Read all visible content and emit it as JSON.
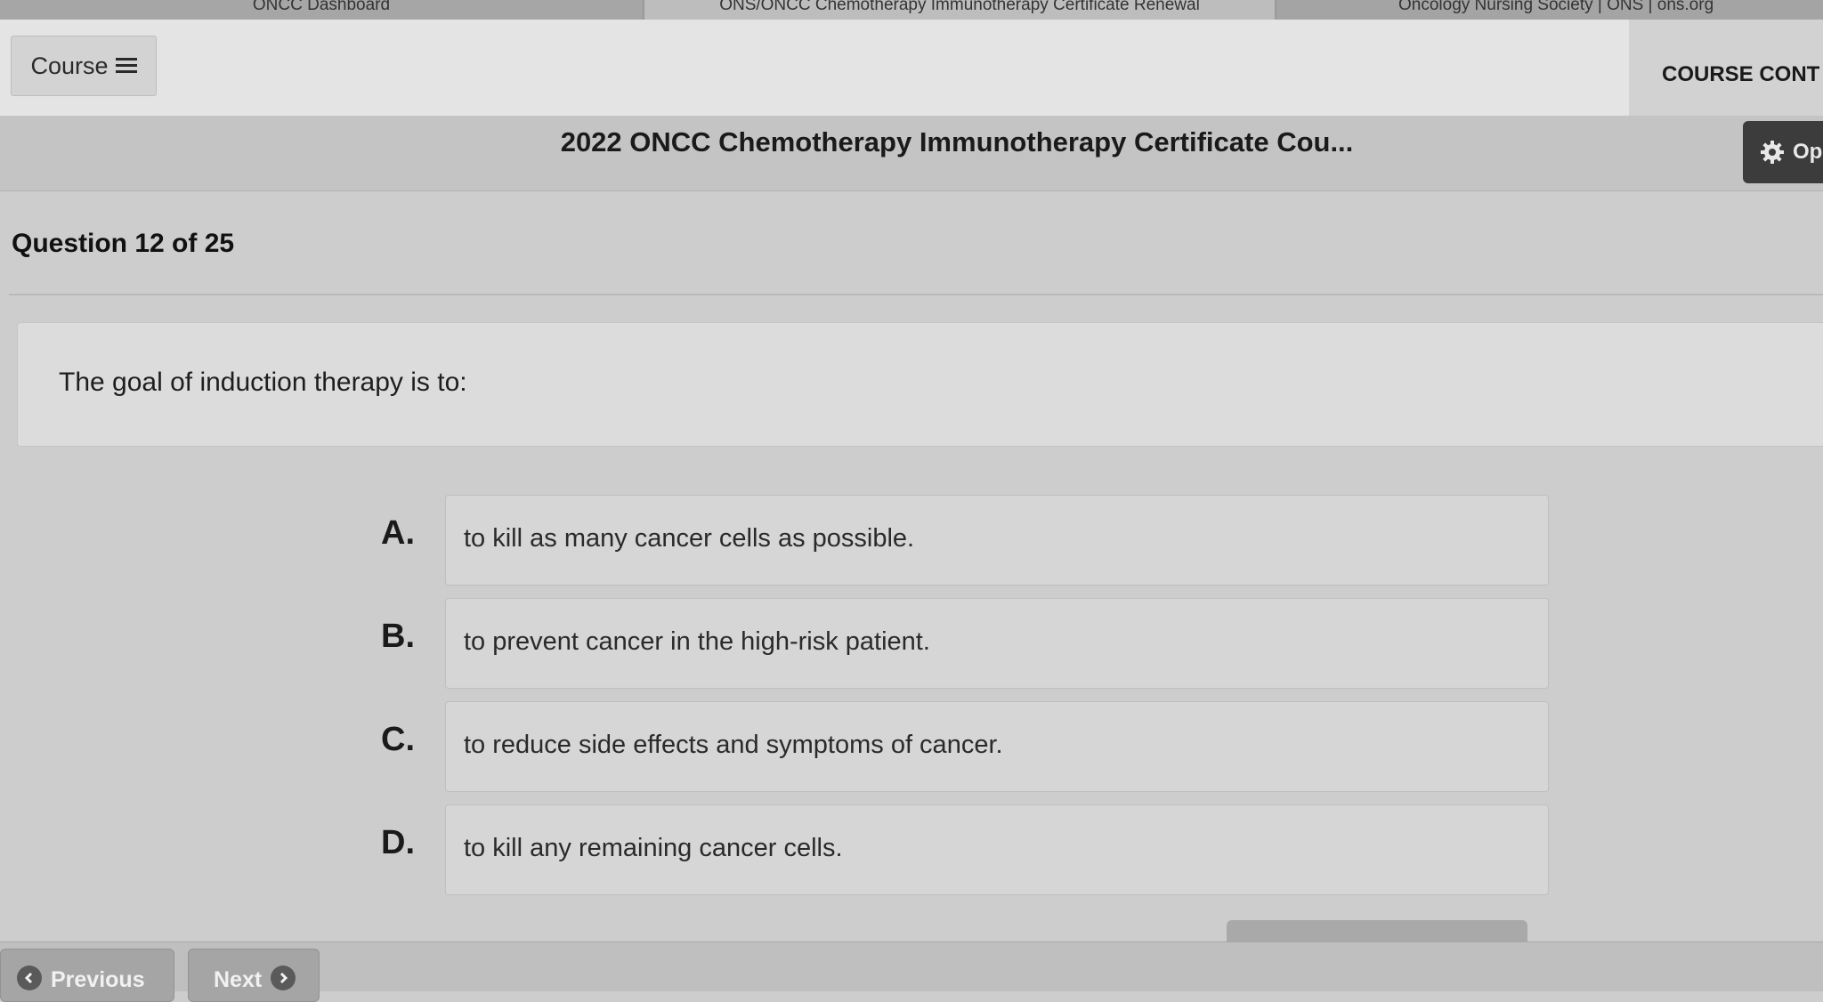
{
  "browser": {
    "tabs": [
      {
        "label": "ONCC Dashboard"
      },
      {
        "label": "ONS/ONCC Chemotherapy Immunotherapy Certificate Renewal"
      },
      {
        "label": "Oncology Nursing Society | ONS | ons.org"
      }
    ]
  },
  "header": {
    "course_button_label": "Course",
    "course_contents_label": "COURSE CONT",
    "course_title": "2022 ONCC Chemotherapy Immunotherapy Certificate Cou...",
    "options_label": "Op"
  },
  "quiz": {
    "question_header": "Question 12 of 25",
    "prompt": "The goal of induction therapy is to:",
    "answers": [
      {
        "letter": "A.",
        "text": "to kill as many cancer cells as possible."
      },
      {
        "letter": "B.",
        "text": "to prevent cancer in the high-risk patient."
      },
      {
        "letter": "C.",
        "text": "to reduce side effects and symptoms of cancer."
      },
      {
        "letter": "D.",
        "text": "to kill any remaining cancer cells."
      }
    ]
  },
  "navigation": {
    "previous_label": "Previous",
    "next_label": "Next"
  },
  "icons": {
    "menu": "hamburger-icon",
    "options": "gear-icon",
    "previous": "chevron-left-icon",
    "next": "chevron-right-icon"
  }
}
